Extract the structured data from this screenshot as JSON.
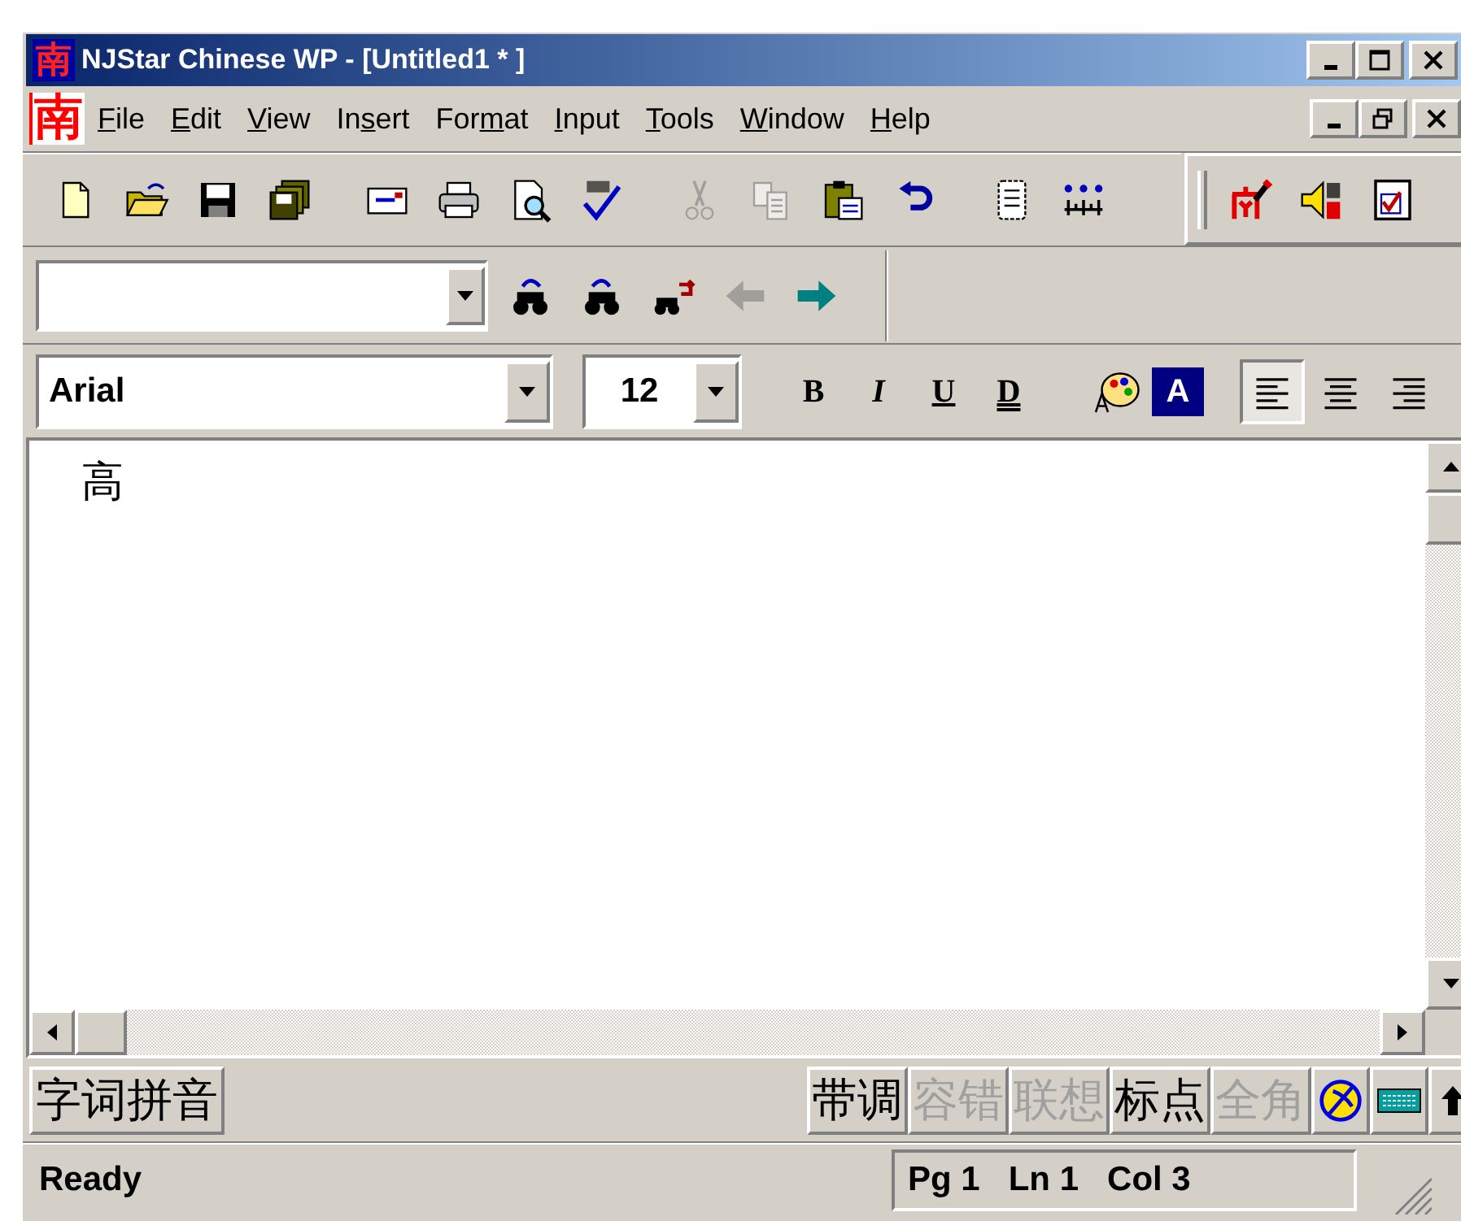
{
  "window": {
    "title": "NJStar Chinese WP - [Untitled1 * ]",
    "app_icon_char": "南"
  },
  "menu_bar": {
    "doc_icon_char": "南",
    "items": [
      {
        "key": "F",
        "after": "ile"
      },
      {
        "key": "E",
        "after": "dit"
      },
      {
        "key": "V",
        "after": "iew"
      },
      {
        "before": "In",
        "key": "s",
        "after": "ert"
      },
      {
        "before": "For",
        "key": "m",
        "after": "at"
      },
      {
        "key": "I",
        "after": "nput"
      },
      {
        "key": "T",
        "after": "ools"
      },
      {
        "key": "W",
        "after": "indow"
      },
      {
        "key": "H",
        "after": "elp"
      }
    ]
  },
  "standard_toolbar": [
    [
      {
        "disabled": false
      },
      {
        "disabled": false
      },
      {
        "disabled": false
      },
      {
        "disabled": false
      }
    ],
    [
      {
        "disabled": false
      },
      {
        "disabled": false
      },
      {
        "disabled": false
      },
      {
        "disabled": false
      }
    ],
    [
      {
        "disabled": true
      },
      {
        "disabled": true
      },
      {
        "disabled": false
      },
      {
        "disabled": false
      }
    ],
    [
      {
        "disabled": false
      },
      {
        "disabled": false
      }
    ]
  ],
  "chinese_toolbar": [
    {
      "disabled": false
    },
    {
      "disabled": false
    },
    {
      "disabled": false
    }
  ],
  "find_toolbar": {
    "buttons": [
      {
        "disabled": false
      },
      {
        "disabled": false
      },
      {
        "disabled": false
      },
      {
        "disabled": true
      },
      {
        "disabled": false
      }
    ]
  },
  "format_toolbar": {
    "font": "Arial",
    "size": "12",
    "styles": [
      "B",
      "I",
      "U",
      "D"
    ],
    "highlight_label": "A",
    "align": [
      {
        "selected": true
      },
      {
        "selected": false
      },
      {
        "selected": false
      }
    ]
  },
  "document": {
    "text": "高"
  },
  "ime_bar": {
    "mode": "字词拼音",
    "toggles": [
      {
        "label": "带调",
        "disabled": false
      },
      {
        "label": "容错",
        "disabled": true
      },
      {
        "label": "联想",
        "disabled": true
      },
      {
        "label": "标点",
        "disabled": false
      },
      {
        "label": "全角",
        "disabled": true
      }
    ]
  },
  "status_bar": {
    "message": "Ready",
    "position": "Pg 1   Ln 1   Col 3"
  }
}
